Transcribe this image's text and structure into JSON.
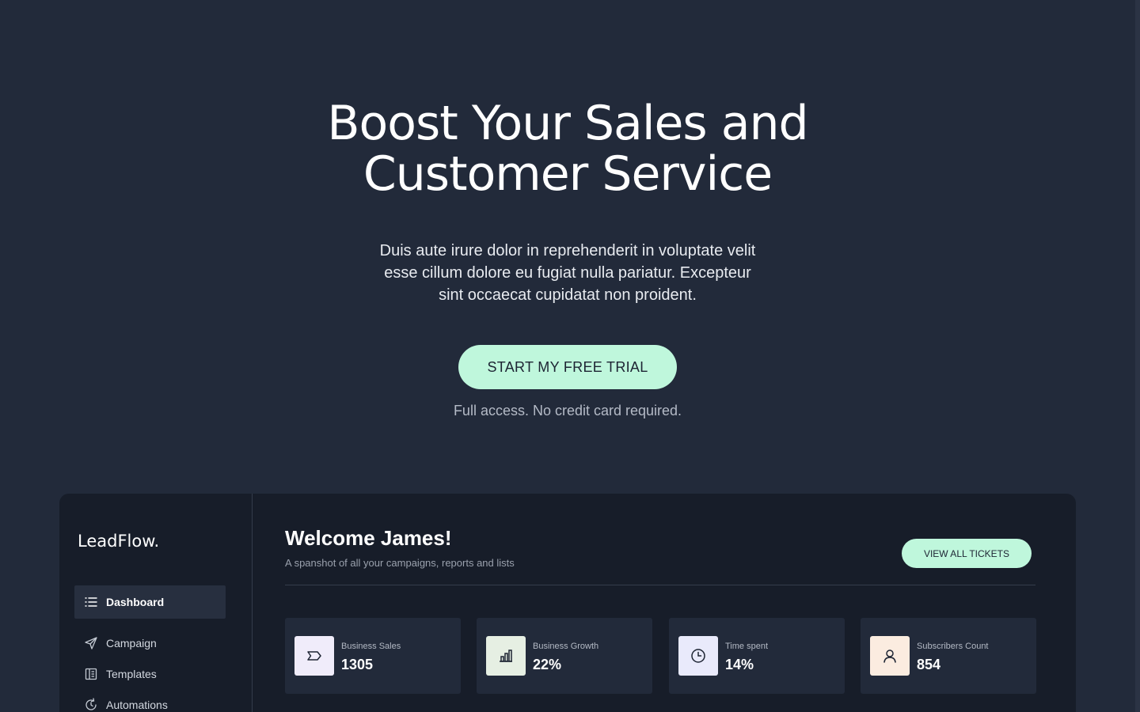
{
  "hero": {
    "title_line1": "Boost Your Sales and",
    "title_line2": "Customer Service",
    "description": "Duis aute irure dolor in reprehenderit in voluptate velit esse cillum dolore eu fugiat nulla pariatur. Excepteur sint occaecat cupidatat non proident.",
    "cta_label": "START MY FREE TRIAL",
    "cta_note": "Full access. No credit card required."
  },
  "app": {
    "logo": "LeadFlow.",
    "nav": [
      {
        "label": "Dashboard",
        "icon": "list-icon",
        "active": true
      },
      {
        "label": "Campaign",
        "icon": "send-icon",
        "active": false
      },
      {
        "label": "Templates",
        "icon": "book-icon",
        "active": false
      },
      {
        "label": "Automations",
        "icon": "refresh-icon",
        "active": false
      }
    ],
    "welcome": "Welcome James!",
    "subtitle": "A spanshot of all your campaigns, reports and lists",
    "tickets_label": "VIEW ALL TICKETS",
    "stats": [
      {
        "label": "Business Sales",
        "value": "1305",
        "icon": "tag-icon",
        "icon_bg": "#f0ecfa"
      },
      {
        "label": "Business Growth",
        "value": "22%",
        "icon": "bar-chart-icon",
        "icon_bg": "#e6efe3"
      },
      {
        "label": "Time spent",
        "value": "14%",
        "icon": "clock-icon",
        "icon_bg": "#e9eafb"
      },
      {
        "label": "Subscribers Count",
        "value": "854",
        "icon": "user-icon",
        "icon_bg": "#fbece0"
      }
    ]
  },
  "colors": {
    "background": "#222a3a",
    "panel": "#171d29",
    "card": "#222a3a",
    "accent": "#bff7dc"
  }
}
